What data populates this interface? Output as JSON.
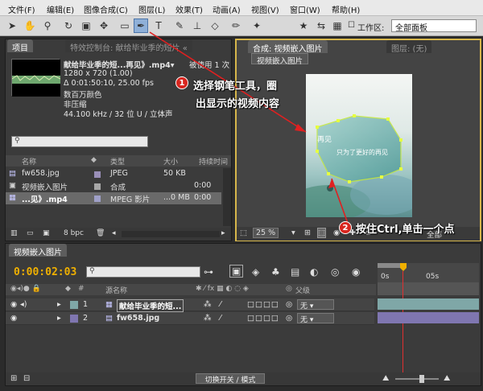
{
  "menubar": {
    "items": [
      "文件(F)",
      "编辑(E)",
      "图像合成(C)",
      "图层(L)",
      "效果(T)",
      "动画(A)",
      "视图(V)",
      "窗口(W)",
      "帮助(H)"
    ]
  },
  "toolbar": {
    "workspace_label": "工作区:",
    "workspace_value": "全部面板"
  },
  "project_panel": {
    "tab_project": "项目",
    "tab_effects": "特效控制台: 献给毕业季的短片 « ",
    "selected_name": "献给毕业季的短...再见》.mp4▾",
    "used_count": "被使用 1 次",
    "dimensions": "1280 x 720 (1.00)",
    "duration": "Δ 0:01:50:10, 25.00 fps",
    "colors": "数百万颜色",
    "compression": "非压缩",
    "audio": "44.100 kHz / 32 位 U / 立体声",
    "search_icon_glyph": "⚲",
    "columns": {
      "name": "名称",
      "type": "类型",
      "size": "大小",
      "duration": "持续时间"
    },
    "rows": [
      {
        "name": "fw658.jpg",
        "type": "JPEG",
        "size": "50 KB",
        "duration": "",
        "color": "#9a8fb8"
      },
      {
        "name": "视频嵌入图片",
        "type": "合成",
        "size": "",
        "duration": "0:00",
        "color": "#a7a7a7"
      },
      {
        "name": "...见》.mp4",
        "type": "MPEG 影片",
        "size": "...0 MB",
        "duration": "0:00",
        "color": "#9fa0c8"
      }
    ],
    "bpc": "8 bpc"
  },
  "comp_panel": {
    "tab_comp": "合成: 视频嵌入图片",
    "tab_layer": "图层: (无)",
    "crumb": "视频嵌入图片",
    "image_text_1": "再见",
    "image_text_2": "只为了更好的再见",
    "zoom": "25 %",
    "view_full": "全部"
  },
  "timeline": {
    "tab": "视频嵌入图片",
    "timecode": "0:00:02:03",
    "columns": {
      "source_name": "源名称",
      "parent": "父级"
    },
    "ruler_labels": [
      "0s",
      "05s"
    ],
    "layers": [
      {
        "num": "1",
        "name": "献给毕业季的短...",
        "parent": "无",
        "track_color": "#7fa7a7"
      },
      {
        "num": "2",
        "name": "fw658.jpg",
        "parent": "无",
        "track_color": "#7f76b0"
      }
    ],
    "switch_mode": "切换开关 / 模式"
  },
  "callouts": {
    "step1_num": "1",
    "step1_line1": "选择钢笔工具，圈",
    "step1_line2": "出显示的视频内容",
    "step2_num": "2",
    "step2_text": "按住Ctrl,单击一个点"
  }
}
